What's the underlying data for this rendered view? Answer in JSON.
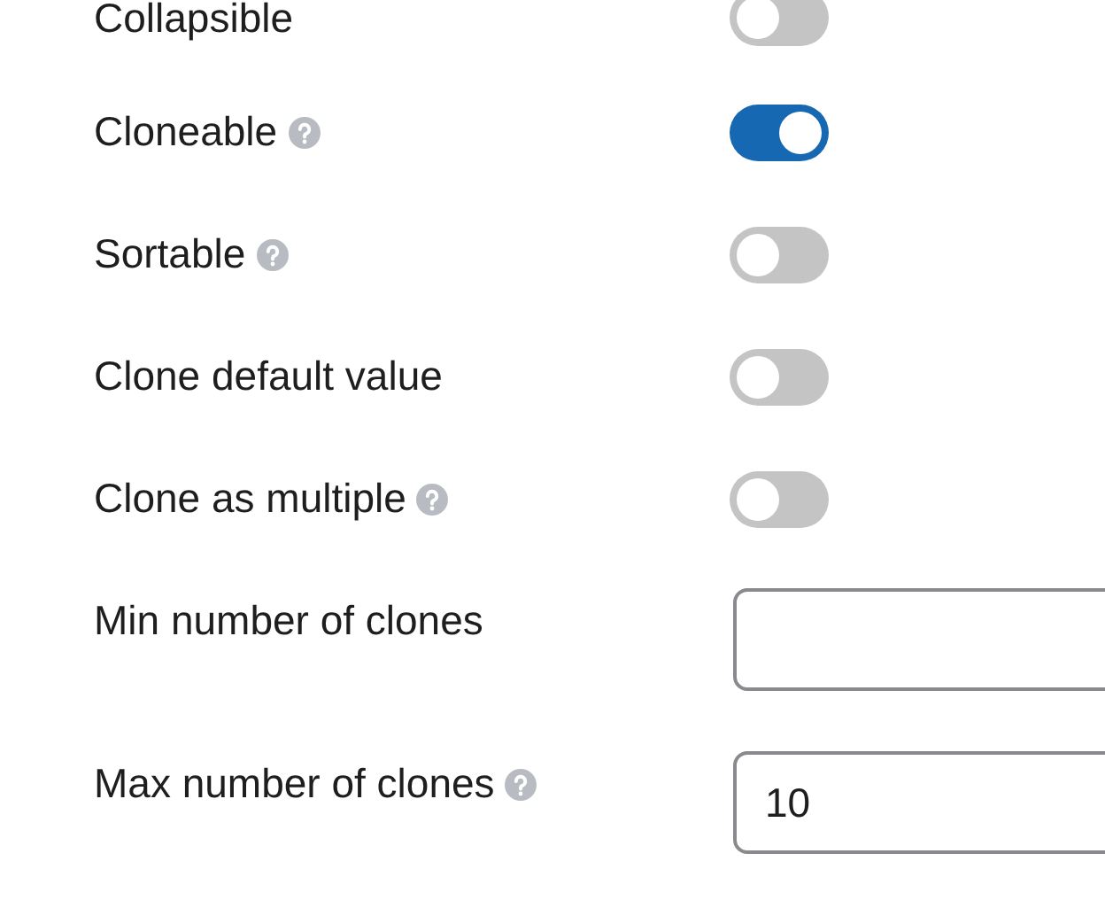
{
  "settings": [
    {
      "kind": "toggle",
      "label": "Collapsible",
      "help": false,
      "on": false
    },
    {
      "kind": "toggle",
      "label": "Cloneable",
      "help": true,
      "on": true
    },
    {
      "kind": "toggle",
      "label": "Sortable",
      "help": true,
      "on": false
    },
    {
      "kind": "toggle",
      "label": "Clone default value",
      "help": false,
      "on": false
    },
    {
      "kind": "toggle",
      "label": "Clone as multiple",
      "help": true,
      "on": false
    },
    {
      "kind": "number",
      "label": "Min number of clones",
      "help": false
    },
    {
      "kind": "number",
      "label": "Max number of clones",
      "help": true,
      "value": "10"
    }
  ]
}
